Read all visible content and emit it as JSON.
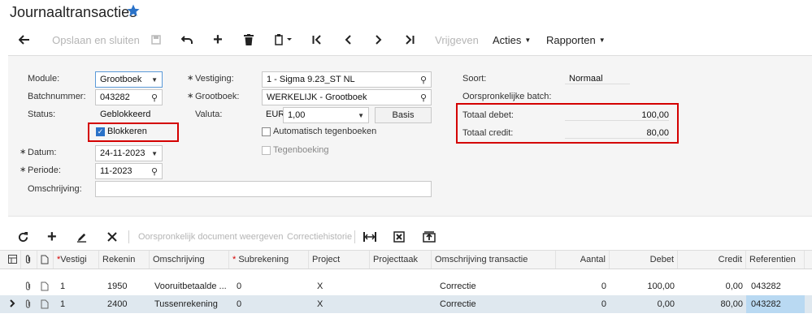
{
  "page": {
    "title": "Journaaltransacties"
  },
  "toolbar": {
    "save_close": "Opslaan en sluiten",
    "release": "Vrijgeven",
    "actions": "Acties",
    "reports": "Rapporten"
  },
  "form": {
    "module_label": "Module:",
    "module_value": "Grootboek",
    "batch_label": "Batchnummer:",
    "batch_value": "043282",
    "status_label": "Status:",
    "status_value": "Geblokkeerd",
    "hold_label": "Blokkeren",
    "date_label": "Datum:",
    "date_value": "24-11-2023",
    "period_label": "Periode:",
    "period_value": "11-2023",
    "desc_label": "Omschrijving:",
    "desc_value": "",
    "branch_label": "Vestiging:",
    "branch_value": "1 - Sigma 9.23_ST NL",
    "ledger_label": "Grootboek:",
    "ledger_value": "WERKELIJK - Grootboek",
    "currency_label": "Valuta:",
    "currency_value": "EUR",
    "rate_value": "1,00",
    "base_button": "Basis",
    "auto_reverse_label": "Automatisch tegenboeken",
    "reversing_label": "Tegenboeking",
    "type_label": "Soort:",
    "type_value": "Normaal",
    "orig_batch_label": "Oorspronkelijke batch:",
    "debit_total_label": "Totaal debet:",
    "debit_total_value": "100,00",
    "credit_total_label": "Totaal credit:",
    "credit_total_value": "80,00"
  },
  "grid_toolbar": {
    "view_orig_doc": "Oorspronkelijk document weergeven",
    "correction_history": "Correctiehistorie"
  },
  "grid": {
    "columns": {
      "branch": "Vestigi",
      "account": "Rekenin",
      "description": "Omschrijving",
      "subaccount": "Subrekening",
      "project": "Project",
      "project_task": "Projecttaak",
      "tran_desc": "Omschrijving transactie",
      "qty": "Aantal",
      "debit": "Debet",
      "credit": "Credit",
      "reference": "Referentien"
    },
    "rows": [
      {
        "branch": "1",
        "account": "1950",
        "description": "Vooruitbetaalde ...",
        "subaccount": "0",
        "project": "X",
        "project_task": "",
        "tran_desc": "Correctie",
        "qty": "0",
        "debit": "100,00",
        "credit": "0,00",
        "reference": "043282"
      },
      {
        "branch": "1",
        "account": "2400",
        "description": "Tussenrekening",
        "subaccount": "0",
        "project": "X",
        "project_task": "",
        "tran_desc": "Correctie",
        "qty": "0",
        "debit": "0,00",
        "credit": "80,00",
        "reference": "043282"
      }
    ]
  },
  "colors": {
    "accent": "#2a72c8",
    "highlight": "#d40000"
  }
}
